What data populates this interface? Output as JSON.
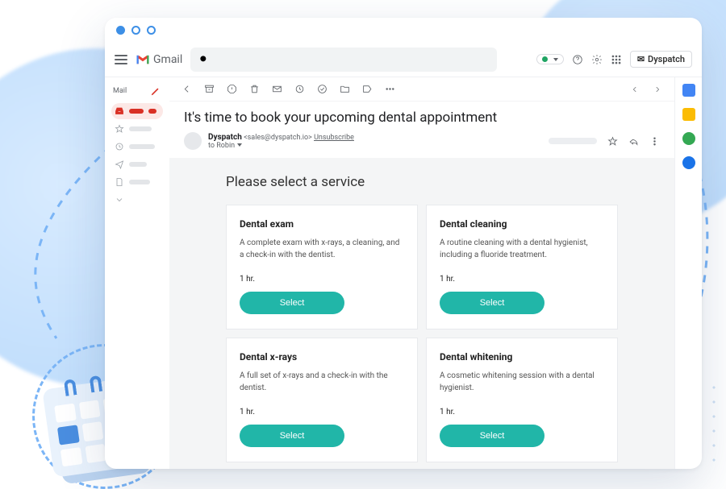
{
  "app": {
    "name": "Gmail"
  },
  "header": {
    "search_placeholder": "",
    "account_button": "Dyspatch"
  },
  "sidebar": {
    "label": "Mail"
  },
  "toolbar_nav": {},
  "email": {
    "subject": "It's time to book your upcoming dental appointment",
    "from_name": "Dyspatch",
    "from_addr": "<sales@dyspatch.io>",
    "unsubscribe": "Unsubscribe",
    "to_line": "to Robin",
    "body": {
      "heading": "Please select a service",
      "services": [
        {
          "title": "Dental exam",
          "desc": "A complete exam with x-rays, a cleaning, and a check-in with the dentist.",
          "duration": "1 hr.",
          "cta": "Select"
        },
        {
          "title": "Dental cleaning",
          "desc": "A routine cleaning with a dental hygienist, including a fluoride treatment.",
          "duration": "1 hr.",
          "cta": "Select"
        },
        {
          "title": "Dental x-rays",
          "desc": "A full set of x-rays and a check-in with the dentist.",
          "duration": "1 hr.",
          "cta": "Select"
        },
        {
          "title": "Dental whitening",
          "desc": "A cosmetic whitening session with a dental hygienist.",
          "duration": "1 hr.",
          "cta": "Select"
        }
      ]
    }
  },
  "colors": {
    "accent_teal": "#21b6a8",
    "gmail_red": "#d93025",
    "link_blue": "#3d8fe6"
  }
}
